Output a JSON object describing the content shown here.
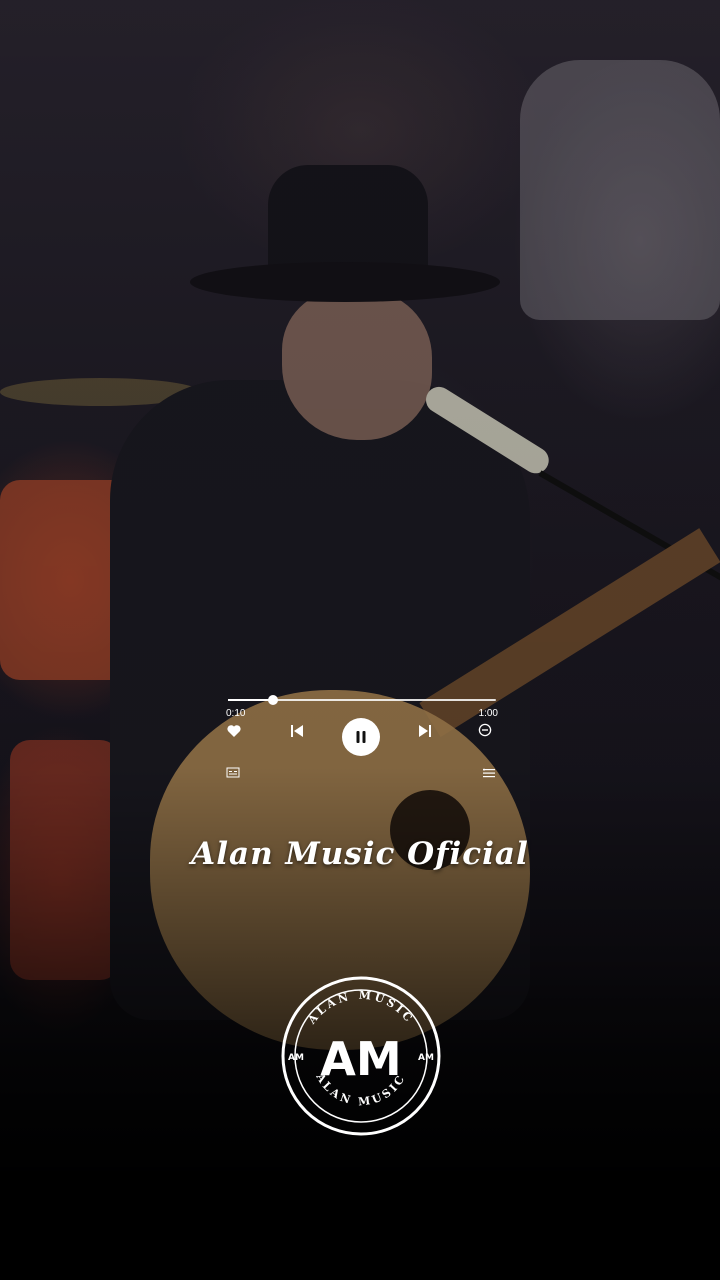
{
  "player": {
    "current_time": "0:10",
    "total_time": "1:00",
    "progress": 0.167,
    "is_playing": true
  },
  "channel": {
    "name": "Alan Music Oficial"
  },
  "logo": {
    "monogram": "AM",
    "ring_text": "ALAN MUSIC",
    "side_mark": "AM"
  },
  "icons": {
    "like": "heart-icon",
    "previous": "skip-previous-icon",
    "play_pause": "pause-icon",
    "next": "skip-next-icon",
    "remove": "minus-circle-icon",
    "lyrics": "lyrics-icon",
    "playlist": "playlist-icon"
  },
  "colors": {
    "accent": "#ffffff",
    "background": "#000000"
  }
}
